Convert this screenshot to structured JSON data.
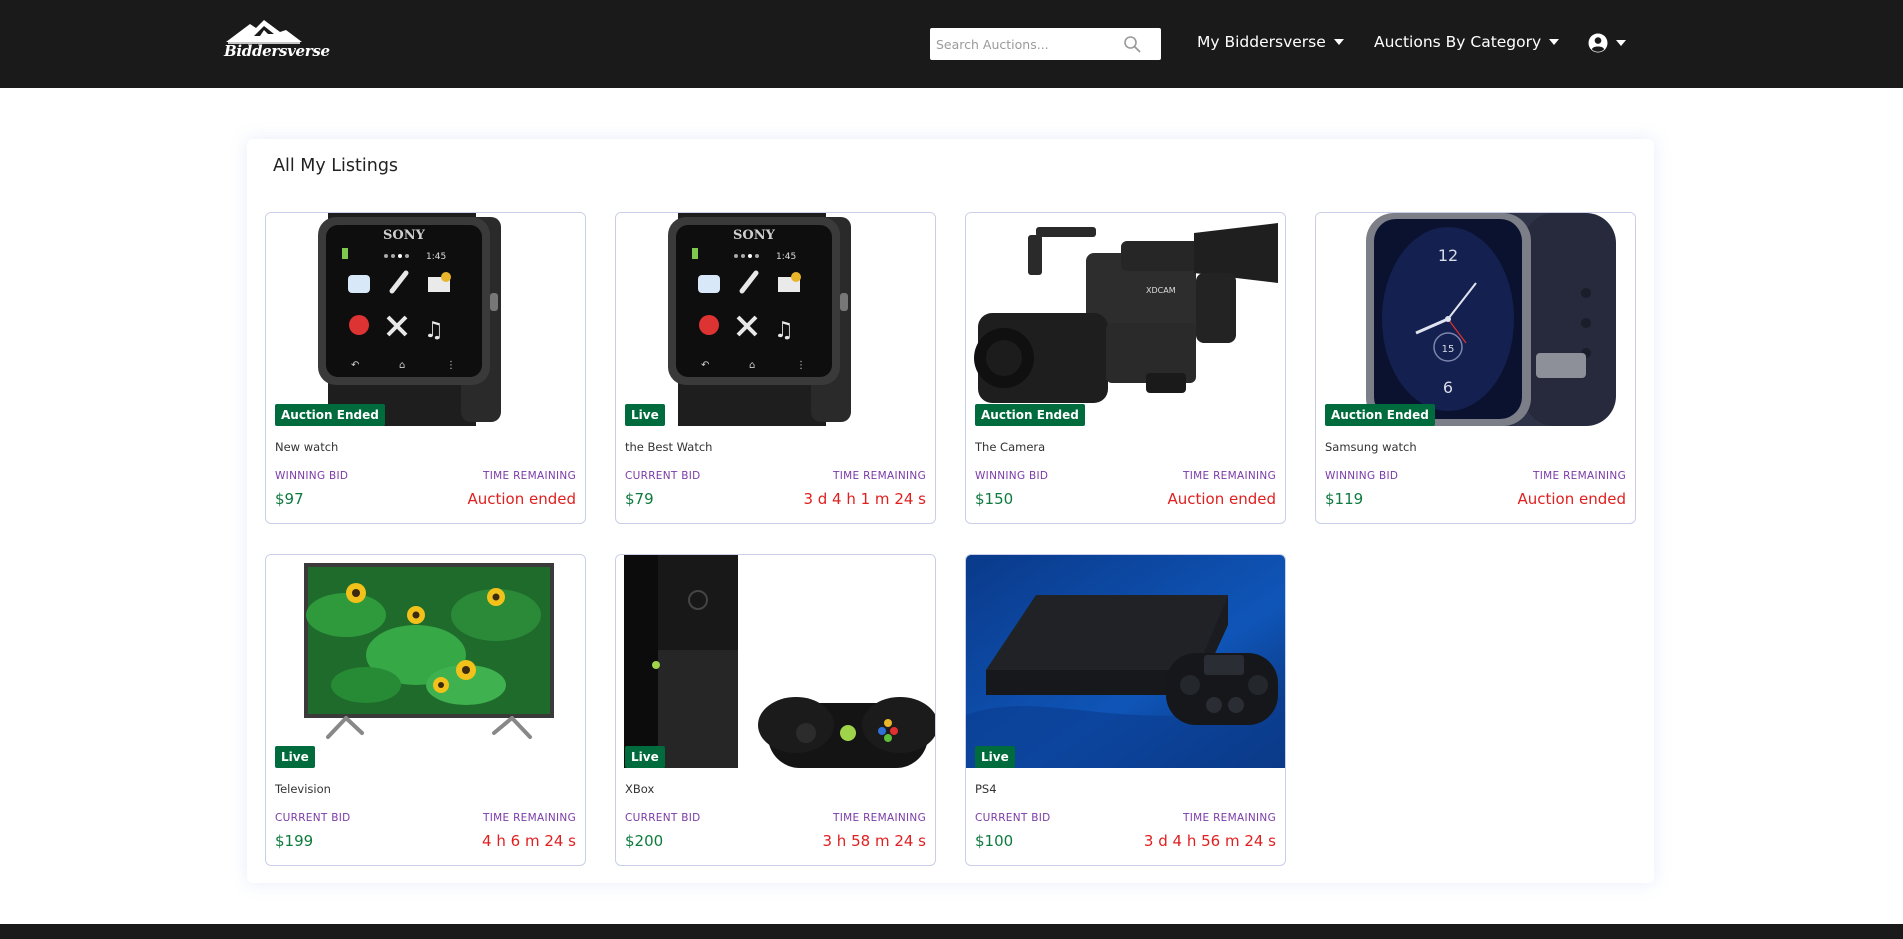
{
  "navbar": {
    "logo_text": "Biddersverse",
    "search_placeholder": "Search Auctions...",
    "menu_my": "My Biddersverse",
    "menu_category": "Auctions By Category"
  },
  "page": {
    "title": "All My Listings"
  },
  "listings": [
    {
      "title": "New watch",
      "status": "Auction Ended",
      "bid_label": "WINNING BID",
      "bid": "$97",
      "time_label": "TIME REMAINING",
      "time": "Auction ended",
      "image": "sony-smartwatch"
    },
    {
      "title": "the Best Watch",
      "status": "Live",
      "bid_label": "CURRENT BID",
      "bid": "$79",
      "time_label": "TIME REMAINING",
      "time": "3 d 4 h 1 m 24 s",
      "image": "sony-smartwatch"
    },
    {
      "title": "The Camera",
      "status": "Auction Ended",
      "bid_label": "WINNING BID",
      "bid": "$150",
      "time_label": "TIME REMAINING",
      "time": "Auction ended",
      "image": "video-camera"
    },
    {
      "title": "Samsung watch",
      "status": "Auction Ended",
      "bid_label": "WINNING BID",
      "bid": "$119",
      "time_label": "TIME REMAINING",
      "time": "Auction ended",
      "image": "samsung-watch"
    },
    {
      "title": "Television",
      "status": "Live",
      "bid_label": "CURRENT BID",
      "bid": "$199",
      "time_label": "TIME REMAINING",
      "time": "4 h 6 m 24 s",
      "image": "television"
    },
    {
      "title": "XBox",
      "status": "Live",
      "bid_label": "CURRENT BID",
      "bid": "$200",
      "time_label": "TIME REMAINING",
      "time": "3 h 58 m 24 s",
      "image": "xbox"
    },
    {
      "title": "PS4",
      "status": "Live",
      "bid_label": "CURRENT BID",
      "bid": "$100",
      "time_label": "TIME REMAINING",
      "time": "3 d 4 h 56 m 24 s",
      "image": "ps4"
    }
  ],
  "colors": {
    "navbar_bg": "#1b1a1a",
    "badge_green": "#006b3c",
    "bid_green": "#0e7a3e",
    "time_red": "#e02020",
    "label_purple": "#7a3aa8"
  }
}
